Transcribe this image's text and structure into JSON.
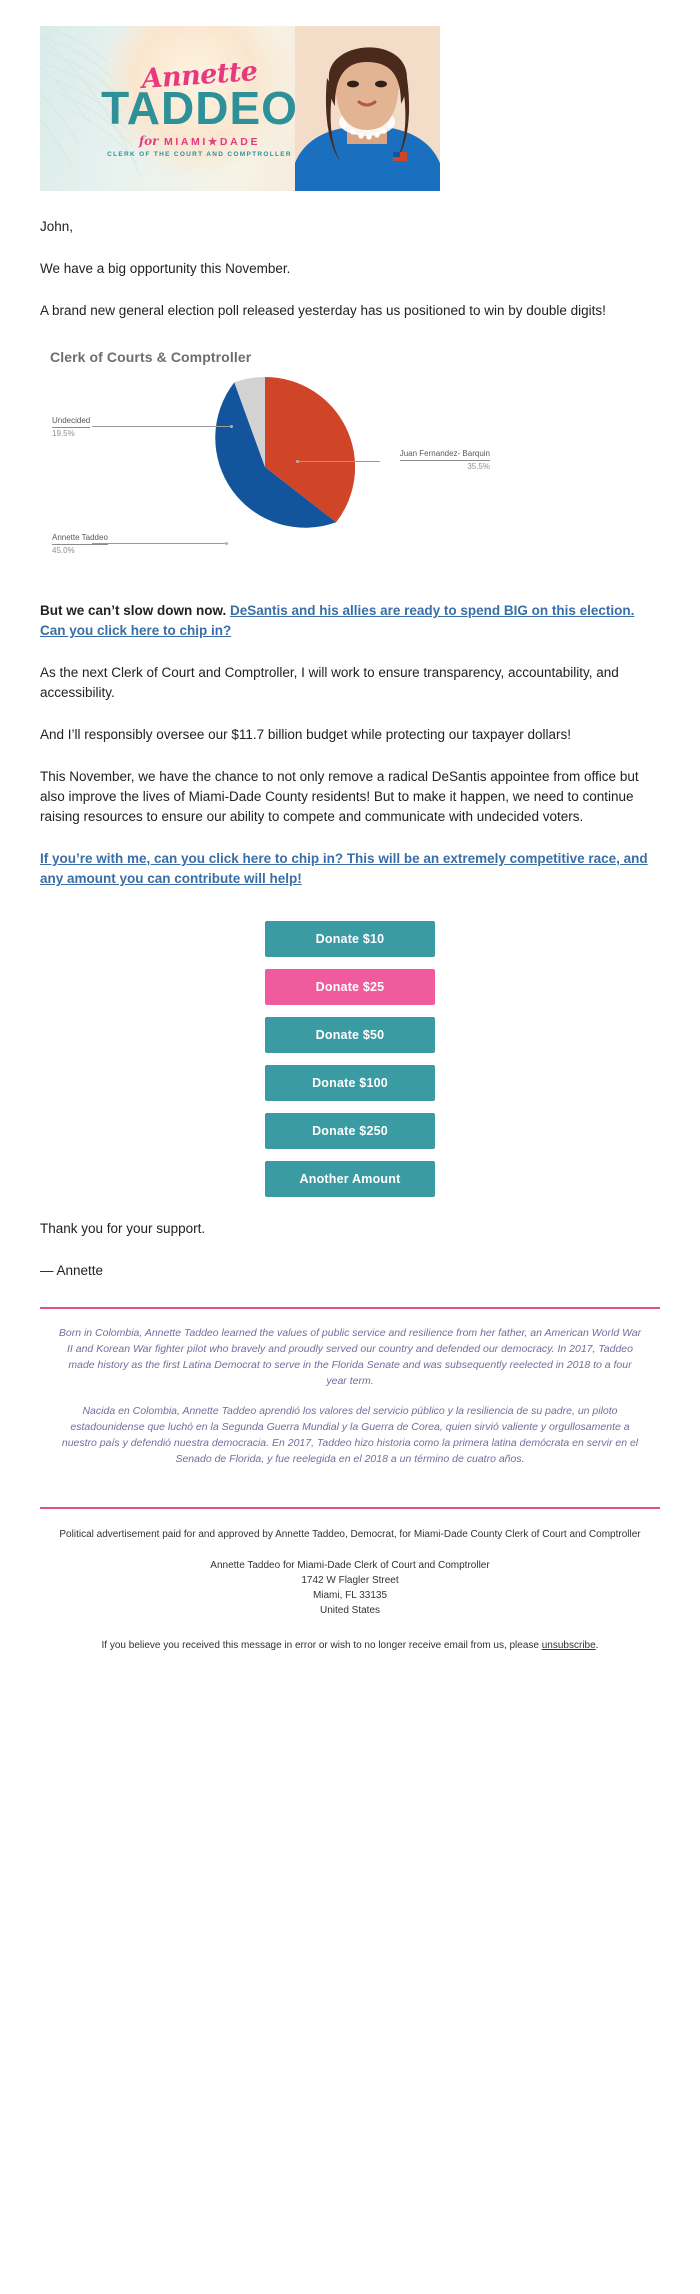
{
  "banner": {
    "script_name": "Annette",
    "last_name": "TADDEO",
    "for_word": "for",
    "jurisdiction": "MIAMI★DADE",
    "office_line": "CLERK OF THE COURT AND COMPTROLLER"
  },
  "letter": {
    "salutation": "John,",
    "p1": "We have a big opportunity this November.",
    "p2": "A brand new general election poll released yesterday has us positioned to win by double digits!",
    "p3_lead": "But we can’t slow down now. ",
    "p3_link": "DeSantis and his allies are ready to spend BIG on this election. Can you click here to chip in?",
    "p4": "As the next Clerk of Court and Comptroller, I will work to ensure transparency, accountability, and accessibility.",
    "p5": "And I’ll responsibly oversee our $11.7 billion budget while protecting our taxpayer dollars!",
    "p6": "This November, we have the chance to not only remove a radical DeSantis appointee from office but also improve the lives of Miami-Dade County residents! But to make it happen, we need to continue raising resources to ensure our ability to compete and communicate with undecided voters.",
    "p7_link": "If you’re with me, can you click here to chip in? This will be an extremely competitive race, and any amount you can contribute will help!",
    "thanks": "Thank you for your support.",
    "signoff": "— Annette"
  },
  "chart_data": {
    "type": "pie",
    "title": "Clerk of Courts & Comptroller",
    "categories": [
      "Juan Fernandez- Barquin",
      "Annette Taddeo",
      "Undecided"
    ],
    "values": [
      35.5,
      45.0,
      19.5
    ],
    "value_labels": [
      "35.5%",
      "45.0%",
      "19.5%"
    ],
    "colors": [
      "#d04428",
      "#12559d",
      "#d2d2d2"
    ],
    "legend": "labeled-callouts",
    "xlabel": "",
    "ylabel": ""
  },
  "donate": {
    "buttons": [
      {
        "label": "Donate $10",
        "style": "teal"
      },
      {
        "label": "Donate $25",
        "style": "pink"
      },
      {
        "label": "Donate $50",
        "style": "teal"
      },
      {
        "label": "Donate $100",
        "style": "teal"
      },
      {
        "label": "Donate $250",
        "style": "teal"
      },
      {
        "label": "Another Amount",
        "style": "teal"
      }
    ]
  },
  "bio": {
    "english": "Born in Colombia, Annette Taddeo learned the values of public service and resilience from her father, an American World War II and Korean War fighter pilot who bravely and proudly served our country and defended our democracy. In 2017, Taddeo made history as the first Latina Democrat to serve in the Florida Senate and was subsequently reelected in 2018 to a four year term.",
    "spanish": "Nacida en Colombia, Annette Taddeo aprendió los valores del servicio público y la resiliencia de su padre, un piloto estadounidense que luchó en la Segunda Guerra Mundial y la Guerra de Corea, quien sirvió valiente y orgullosamente a nuestro país y defendió nuestra democracia. En 2017, Taddeo hizo historia como la primera latina demócrata en servir en el Senado de Florida, y fue reelegida en el 2018 a un término de cuatro años."
  },
  "footer": {
    "disclaimer": "Political advertisement paid for and approved by Annette Taddeo, Democrat, for Miami-Dade County Clerk of Court and Comptroller",
    "org": "Annette Taddeo for Miami-Dade Clerk of Court and Comptroller",
    "street": "1742 W Flagler Street",
    "city": "Miami, FL 33135",
    "country": "United States",
    "unsub_pre": "If you believe you received this message in error or wish to no longer receive email from us, please ",
    "unsub_link": "unsubscribe",
    "unsub_post": "."
  }
}
